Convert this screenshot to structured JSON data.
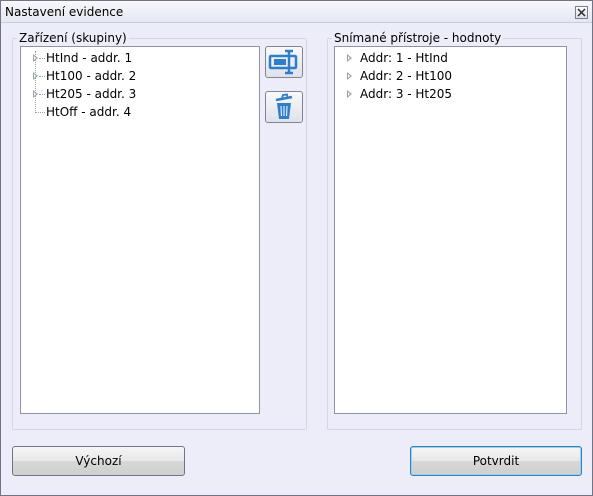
{
  "window": {
    "title": "Nastavení evidence"
  },
  "left_group": {
    "label": "Zařízení (skupiny)",
    "items": [
      {
        "label": "HtInd - addr. 1",
        "expandable": true
      },
      {
        "label": "Ht100 - addr. 2",
        "expandable": true
      },
      {
        "label": "Ht205 - addr. 3",
        "expandable": true
      },
      {
        "label": "HtOff - addr. 4",
        "expandable": false
      }
    ]
  },
  "tools": {
    "edit_icon": "rename-icon",
    "delete_icon": "trash-icon"
  },
  "right_group": {
    "label": "Snímané přístroje - hodnoty",
    "items": [
      {
        "label": "Addr: 1 - HtInd",
        "expandable": true
      },
      {
        "label": "Addr: 2 - Ht100",
        "expandable": true
      },
      {
        "label": "Addr: 3 - Ht205",
        "expandable": true
      }
    ]
  },
  "buttons": {
    "default_label": "Výchozí",
    "confirm_label": "Potvrdit"
  },
  "colors": {
    "window_bg": "#ecedf8",
    "accent_icon": "#2f7fc8"
  }
}
